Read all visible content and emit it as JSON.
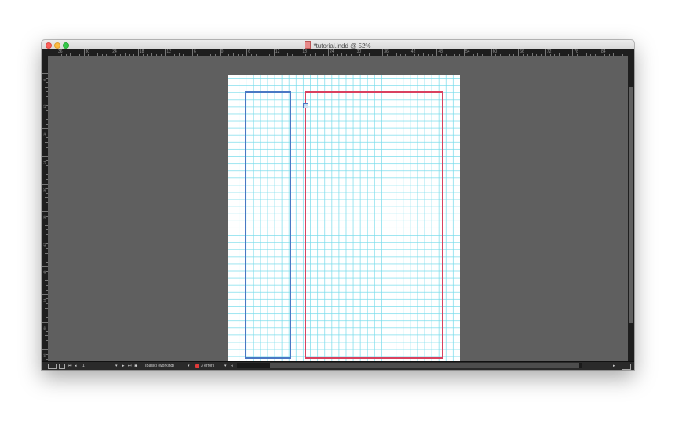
{
  "window": {
    "title": "*tutorial.indd @ 52%"
  },
  "rulers": {
    "horizontal_labels": [
      "36",
      "30",
      "24",
      "18",
      "12",
      "6",
      "0",
      "6",
      "12",
      "18",
      "24",
      "30",
      "36",
      "42",
      "48",
      "54",
      "60",
      "66",
      "72",
      "78",
      "84"
    ],
    "vertical_labels": [
      "6",
      "12",
      "18",
      "24",
      "30",
      "36",
      "42",
      "48",
      "54",
      "60",
      "66"
    ]
  },
  "statusbar": {
    "page_number": "1",
    "style_label": "[Basic] (working)",
    "errors_label": "3 errors"
  },
  "colors": {
    "frame_left": "#4a78c4",
    "frame_right": "#d9415f",
    "grid": "#78dceb",
    "pasteboard": "#5f5f5f"
  }
}
